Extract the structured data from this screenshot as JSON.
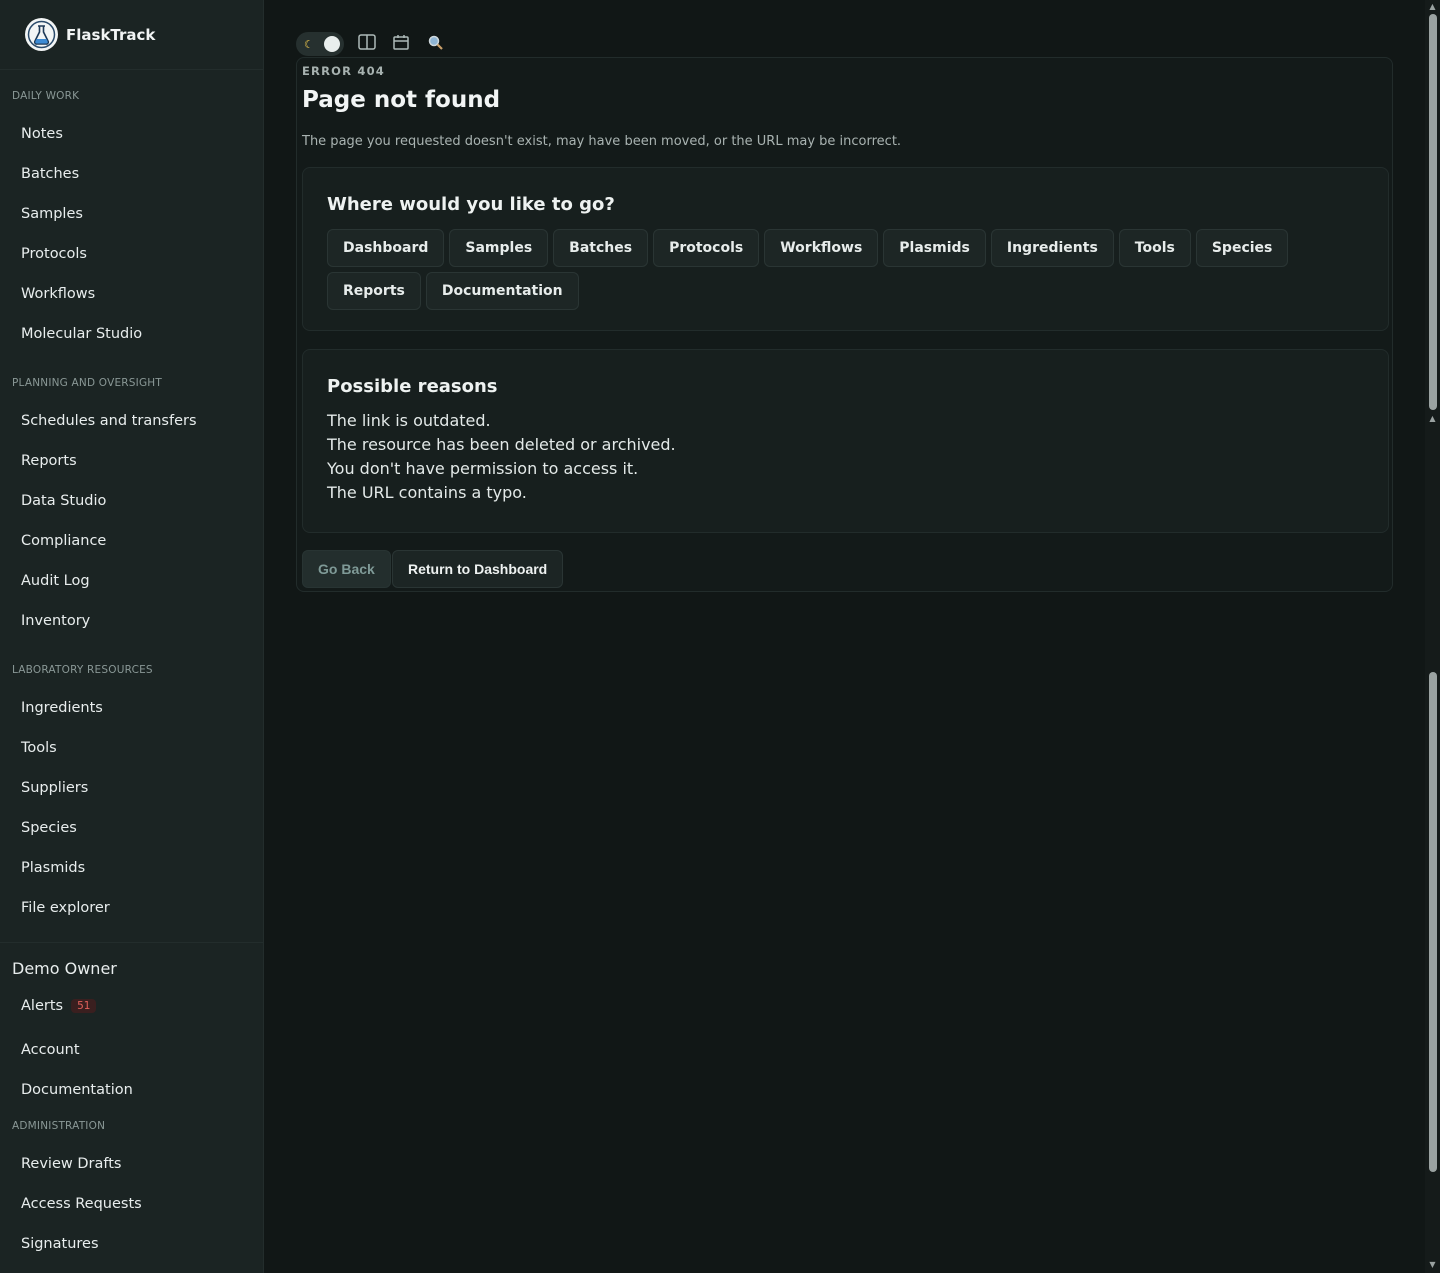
{
  "app": {
    "name": "FlaskTrack"
  },
  "sidebar": {
    "sections": [
      {
        "label": "DAILY WORK",
        "items": [
          "Notes",
          "Batches",
          "Samples",
          "Protocols",
          "Workflows",
          "Molecular Studio"
        ]
      },
      {
        "label": "PLANNING AND OVERSIGHT",
        "items": [
          "Schedules and transfers",
          "Reports",
          "Data Studio",
          "Compliance",
          "Audit Log",
          "Inventory"
        ]
      },
      {
        "label": "LABORATORY RESOURCES",
        "items": [
          "Ingredients",
          "Tools",
          "Suppliers",
          "Species",
          "Plasmids",
          "File explorer"
        ]
      }
    ],
    "user": {
      "name": "Demo Owner",
      "alerts_label": "Alerts",
      "alerts_count": "51",
      "account_label": "Account",
      "docs_label": "Documentation"
    },
    "admin": {
      "label": "ADMINISTRATION",
      "items": [
        "Review Drafts",
        "Access Requests",
        "Signatures"
      ]
    }
  },
  "toolbar": {
    "icons": [
      "moon-icon",
      "columns-icon",
      "calendar-icon",
      "search-icon"
    ]
  },
  "main": {
    "eyebrow": "ERROR 404",
    "title": "Page not found",
    "subtitle": "The page you requested doesn't exist, may have been moved, or the URL may be incorrect.",
    "nav_panel": {
      "title": "Where would you like to go?",
      "links": [
        "Dashboard",
        "Samples",
        "Batches",
        "Protocols",
        "Workflows",
        "Plasmids",
        "Ingredients",
        "Tools",
        "Species",
        "Reports",
        "Documentation"
      ]
    },
    "reasons_panel": {
      "title": "Possible reasons",
      "items": [
        "The link is outdated.",
        "The resource has been deleted or archived.",
        "You don't have permission to access it.",
        "The URL contains a typo."
      ]
    },
    "buttons": {
      "back": "Go Back",
      "dashboard": "Return to Dashboard"
    }
  },
  "colors": {
    "background": "#111716",
    "sidebar": "#1b2423",
    "accent_badge": "#e0605a"
  }
}
